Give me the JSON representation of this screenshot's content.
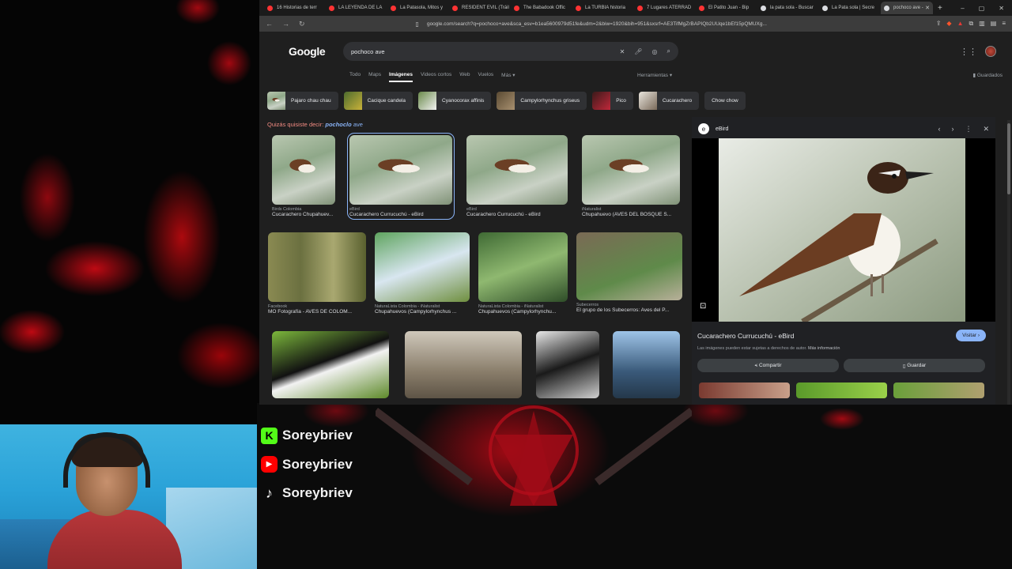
{
  "browser": {
    "tabs": [
      {
        "label": "16 Historias de terr",
        "icon": "youtube-icon"
      },
      {
        "label": "LA LEYENDA DE LA",
        "icon": "youtube-icon"
      },
      {
        "label": "La Patasola, Mitos y",
        "icon": "youtube-icon"
      },
      {
        "label": "RESIDENT EVIL (Tráil",
        "icon": "youtube-icon"
      },
      {
        "label": "The Babadook Offic",
        "icon": "youtube-icon"
      },
      {
        "label": "La TURBIA historia",
        "icon": "youtube-icon"
      },
      {
        "label": "7 Lugares ATERRAD",
        "icon": "youtube-icon"
      },
      {
        "label": "El Patito Juan - Bip",
        "icon": "youtube-icon"
      },
      {
        "label": "la pata sola - Buscar",
        "icon": "google-icon"
      },
      {
        "label": "La Pata sola | Secre",
        "icon": "google-icon"
      },
      {
        "label": "pochoco ave -",
        "icon": "google-icon",
        "active": true
      }
    ],
    "new_tab": "+",
    "url": "google.com/search?q=pochoco+ave&sca_esv=b1ea5600979d51fe&udm=2&biw=1920&bih=951&sxsrf=AE3TifMgZrBAPIQb2UUqe1bEf15pQMUXg..."
  },
  "google": {
    "logo": "Google",
    "query": "pochoco ave",
    "nav_tabs": [
      "Todo",
      "Maps",
      "Imágenes",
      "Videos cortos",
      "Web",
      "Vuelos",
      "Más"
    ],
    "active_tab": "Imágenes",
    "tools": "Herramientas",
    "saved": "Guardados",
    "chips": [
      "Pajaro chau chau",
      "Cacique candela",
      "Cyanocorax affinis",
      "Campylorhynchus griseus",
      "Pico",
      "Cucarachero",
      "Chow chow"
    ],
    "did_you_mean_prefix": "Quizás quisiste decir:",
    "did_you_mean_term": "pochoclo",
    "did_you_mean_rest": "ave",
    "results": [
      {
        "source": "Birds Colombia",
        "title": "Cucarachero Chupahuev..."
      },
      {
        "source": "eBird",
        "title": "Cucarachero Currucuchú - eBird"
      },
      {
        "source": "eBird",
        "title": "Cucarachero Currucuchú - eBird"
      },
      {
        "source": "iNaturalist",
        "title": "Chupahuevo (AVES DEL BOSQUE S..."
      },
      {
        "source": "Facebook",
        "title": "MO Fotografía - AVES DE COLOM..."
      },
      {
        "source": "NaturaLista Colombia - iNaturalist",
        "title": "Chupahuevos (Campylorhynchus ..."
      },
      {
        "source": "NaturaLista Colombia - iNaturalist",
        "title": "Chupahuevos (Campylorhynchu..."
      },
      {
        "source": "Subecerros",
        "title": "El grupo de los Subecerros: Aves del P..."
      }
    ],
    "preview": {
      "site": "eBird",
      "title": "Cucarachero Currucuchú - eBird",
      "visit": "Visitar",
      "note": "Las imágenes pueden estar sujetas a derechos de autor.",
      "note_link": "Más información",
      "share": "Compartir",
      "save": "Guardar"
    }
  },
  "overlay": {
    "socials": [
      {
        "platform": "kick",
        "handle": "Soreybriev"
      },
      {
        "platform": "youtube",
        "handle": "Soreybriev"
      },
      {
        "platform": "tiktok",
        "handle": "Soreybriev"
      }
    ]
  }
}
